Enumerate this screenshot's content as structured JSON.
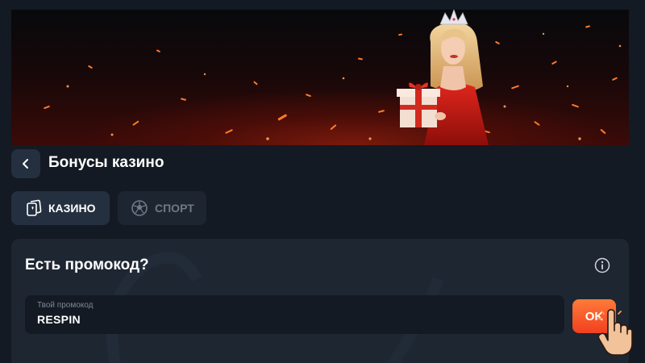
{
  "header": {
    "title": "Бонусы казино"
  },
  "tabs": [
    {
      "label": "КАЗИНО",
      "icon": "cards-icon",
      "active": true
    },
    {
      "label": "СПОРТ",
      "icon": "soccer-ball-icon",
      "active": false
    }
  ],
  "promo": {
    "title": "Есть промокод?",
    "input_label": "Твой промокод",
    "input_value": "RESPIN",
    "ok_label": "OK"
  },
  "colors": {
    "background": "#131a23",
    "card": "#1e2631",
    "button_dark": "#24303f",
    "accent": "#f2401f",
    "muted_text": "#6f7885"
  }
}
